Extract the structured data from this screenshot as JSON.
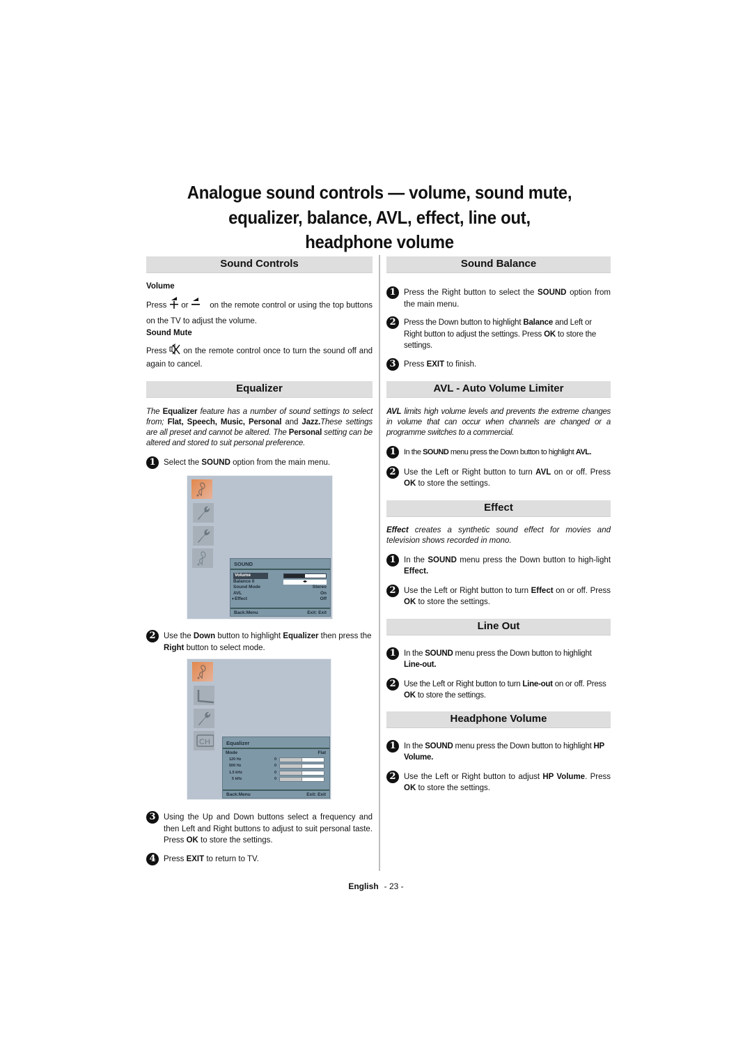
{
  "title": {
    "line1": "Analogue sound controls — volume, sound mute,",
    "line2": "equalizer, balance, AVL, effect, line out,",
    "line3": "headphone volume"
  },
  "left": {
    "sound_controls": {
      "header": "Sound Controls",
      "volume_label": "Volume",
      "volume_text_a": "Press",
      "volume_text_b": "or",
      "volume_text_c": "on the remote control or using the top buttons on the TV to adjust the volume.",
      "mute_label": "Sound Mute",
      "mute_text_a": "Press",
      "mute_text_b": "on the remote control once to turn the sound off and again to cancel.",
      "icons": [
        "volume-up-icon",
        "volume-down-icon",
        "mute-icon"
      ]
    },
    "equalizer": {
      "header": "Equalizer",
      "intro": {
        "t1": "The ",
        "b1": "Equalizer",
        "t2": " feature has a number of sound settings to select from; ",
        "b2": "Flat, Speech, Music, Personal",
        "t3": " and ",
        "b3": "Jazz.",
        "t4": "These settings are all preset and cannot be altered. The ",
        "b4": "Personal",
        "t5": " setting can be altered and stored to suit personal preference."
      },
      "step1": {
        "num": "1",
        "t1": "Select the ",
        "b1": "SOUND",
        "t2": " option from the main menu."
      },
      "step2": {
        "num": "2",
        "t1": "Use the ",
        "b1": "Down",
        "t2": " button to highlight ",
        "b2": "Equalizer",
        "t3": " then press the ",
        "b3": "Right",
        "t4": " button to select mode."
      },
      "step3": {
        "num": "3",
        "t1": "Using the Up and Down buttons select a frequency and then Left and Right buttons to adjust to suit personal taste. Press ",
        "b1": "OK",
        "t2": " to store the settings."
      },
      "step4": {
        "num": "4",
        "t1": "Press ",
        "b1": "EXIT",
        "t2": " to return to TV."
      }
    },
    "sound_menu": {
      "title": "SOUND",
      "tabs": [
        "music-note-icon",
        "wrench-icon",
        "wrench-icon",
        "music-note-icon"
      ],
      "rows": [
        {
          "label": "Volume",
          "value": "",
          "volume_level": 0.5
        },
        {
          "label": "Balance   0",
          "value": "",
          "balance": 0
        },
        {
          "label": "Sound Mode",
          "value": "Stereo"
        },
        {
          "label": "AVL",
          "value": "On"
        },
        {
          "label": "Effect",
          "value": "Off"
        }
      ],
      "footer_left": "Back:Menu",
      "footer_right": "Exit: Exit"
    },
    "eq_menu": {
      "title": "Equalizer",
      "tabs": [
        "music-note-icon",
        "screen-icon",
        "wrench-icon",
        "channel-icon"
      ],
      "mode_label": "Mode",
      "mode_value": "Flat",
      "bands": [
        {
          "label": "120 Hz",
          "value": "0",
          "level": 0.5
        },
        {
          "label": "500 Hz",
          "value": "0",
          "level": 0.5
        },
        {
          "label": "1.5 kHz",
          "value": "0",
          "level": 0.5
        },
        {
          "label": "5 kHz",
          "value": "0",
          "level": 0.5
        }
      ],
      "footer_left": "Back:Menu",
      "footer_right": "Exit: Exit"
    }
  },
  "right": {
    "balance": {
      "header": "Sound Balance",
      "step1": {
        "num": "1",
        "t1": "Press the Right button to select the ",
        "b1": "SOUND",
        "t2": " option from the main menu."
      },
      "step2": {
        "num": "2",
        "t1": "Press the Down button to highlight ",
        "b1": "Balance",
        "t2": " and Left or Right button to adjust the settings. Press ",
        "b2": "OK",
        "t3": " to store the settings."
      },
      "step3": {
        "num": "3",
        "t1": "Press ",
        "b1": "EXIT",
        "t2": " to finish."
      }
    },
    "avl": {
      "header": "AVL - Auto Volume Limiter",
      "intro_b": "AVL",
      "intro_t": " limits high volume levels and prevents the extreme changes in volume that can occur when channels are changed or a programme switches to a commercial.",
      "step1": {
        "num": "1",
        "t1": "In the ",
        "b1": "SOUND",
        "t2": " menu press the Down button to highlight ",
        "b2": "AVL."
      },
      "step2": {
        "num": "2",
        "t1": "Use the Left or Right button to turn ",
        "b1": "AVL",
        "t2": " on or off. Press ",
        "b2": "OK",
        "t3": " to store the settings."
      }
    },
    "effect": {
      "header": "Effect",
      "intro_b": "Effect",
      "intro_t": " creates a synthetic sound effect for movies and television shows recorded in mono.",
      "step1": {
        "num": "1",
        "t1": "In the ",
        "b1": "SOUND",
        "t2": " menu press the Down button to high-light ",
        "b2": "Effect."
      },
      "step2": {
        "num": "2",
        "t1": "Use the Left or Right button to turn ",
        "b1": "Effect",
        "t2": " on or off. Press ",
        "b2": "OK",
        "t3": " to store the settings."
      }
    },
    "lineout": {
      "header": "Line Out",
      "step1": {
        "num": "1",
        "t1": "In the ",
        "b1": "SOUND",
        "t2": " menu press the Down button to highlight ",
        "b2": "Line-out."
      },
      "step2": {
        "num": "2",
        "t1": "Use the Left or Right button to turn ",
        "b1": "Line-out",
        "t2": " on or off. Press ",
        "b2": "OK",
        "t3": " to store the settings."
      }
    },
    "hp": {
      "header": "Headphone Volume",
      "step1": {
        "num": "1",
        "t1": "In the ",
        "b1": "SOUND",
        "t2": " menu press the Down button to highlight ",
        "b2": "HP Volume."
      },
      "step2": {
        "num": "2",
        "t1": "Use the Left or Right button to adjust ",
        "b1": "HP Volume",
        "t2": ". Press ",
        "b2": "OK",
        "t3": " to store the settings."
      }
    }
  },
  "footer": {
    "language": "English",
    "page": "- 23 -"
  }
}
